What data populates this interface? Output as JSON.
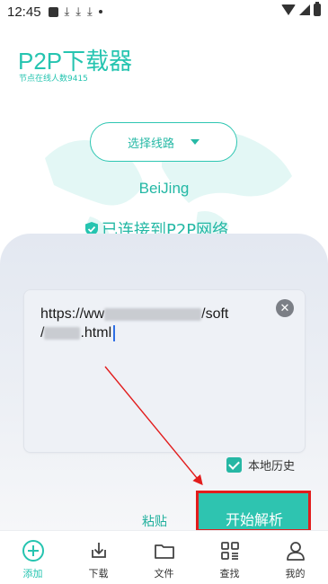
{
  "status_bar": {
    "time": "12:45",
    "left_icons": [
      "square-icon",
      "download-icon",
      "download-icon",
      "download-icon",
      "dot-icon"
    ],
    "right_icons": [
      "wifi-icon",
      "signal-icon",
      "battery-icon"
    ]
  },
  "header": {
    "title": "P2P下载器",
    "node_count": "节点在线人数9415"
  },
  "route": {
    "select_label": "选择线路",
    "city": "BeiJing",
    "connected_text": "已连接到P2P网络"
  },
  "url_input": {
    "line1_start": "https://ww",
    "line1_end": "/soft",
    "line2_start": "/",
    "line2_end": ".html"
  },
  "history_label": "本地历史",
  "actions": {
    "paste": "粘贴",
    "start": "开始解析"
  },
  "bottom_nav": {
    "add": "添加",
    "download": "下载",
    "files": "文件",
    "search": "查找",
    "mine": "我的"
  },
  "colors": {
    "accent": "#25c4b0",
    "annotation_red": "#e21d1d"
  }
}
